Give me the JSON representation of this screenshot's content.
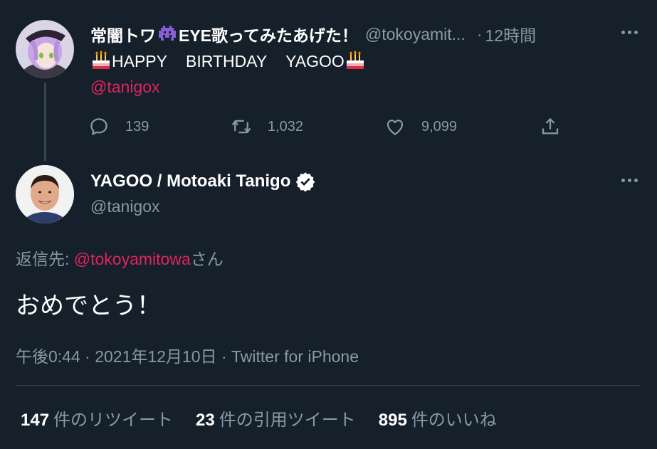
{
  "tweet1": {
    "display_name": "常闇トワ",
    "display_name_suffix": "EYE歌ってみたあげた！",
    "handle": "@tokoyamit...",
    "separator": "·",
    "time": "12時間",
    "text_part1": "HAPPY",
    "text_part2": "BIRTHDAY",
    "text_part3": "YAGOO",
    "mention": "@tanigox",
    "actions": {
      "replies": "139",
      "retweets": "1,032",
      "likes": "9,099"
    }
  },
  "tweet2": {
    "display_name": "YAGOO / Motoaki Tanigo",
    "handle": "@tanigox",
    "reply_prefix": "返信先: ",
    "reply_mention": "@tokoyamitowa",
    "reply_suffix": "さん",
    "text": "おめでとう！",
    "time": "午後0:44",
    "sep1": " · ",
    "date": "2021年12月10日",
    "sep2": " · ",
    "source": "Twitter for iPhone",
    "stats": [
      {
        "count": "147",
        "label": "件のリツイート"
      },
      {
        "count": "23",
        "label": "件の引用ツイート"
      },
      {
        "count": "895",
        "label": "件のいいね"
      }
    ]
  },
  "colors": {
    "background": "#15202b",
    "text_primary": "#ffffff",
    "text_secondary": "#8899a6",
    "mention": "#e0245e",
    "divider": "#38444d"
  }
}
